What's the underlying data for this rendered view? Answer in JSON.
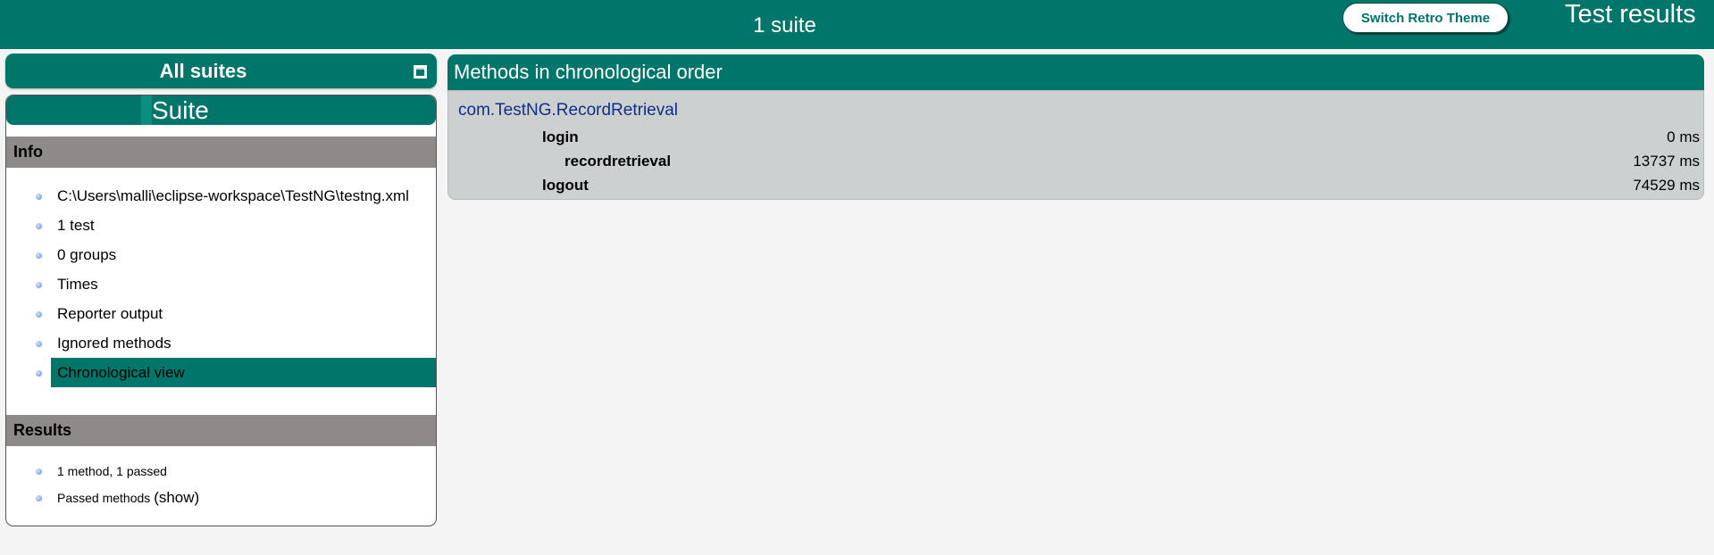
{
  "topbar": {
    "suite_count": "1 suite",
    "retro_button": "Switch Retro Theme",
    "title": "Test results"
  },
  "sidebar": {
    "all_suites": "All suites",
    "suite_name": "Suite",
    "info_heading": "Info",
    "info_items": [
      "C:\\Users\\malli\\eclipse-workspace\\TestNG\\testng.xml",
      "1 test",
      "0 groups",
      "Times",
      "Reporter output",
      "Ignored methods",
      "Chronological view"
    ],
    "results_heading": "Results",
    "results_items": [
      "1 method, 1 passed",
      "Passed methods"
    ],
    "show_link": "(show)"
  },
  "main": {
    "header": "Methods in chronological order",
    "class_name": "com.TestNG.RecordRetrieval",
    "methods": [
      {
        "name": "login",
        "time": "0 ms"
      },
      {
        "name": "recordretrieval",
        "time": "13737 ms"
      },
      {
        "name": "logout",
        "time": "74529 ms"
      }
    ]
  },
  "colors": {
    "accent": "#00756a",
    "section_header": "#8f8a8a",
    "methods_body": "#cdd0d0",
    "class_link": "#0f2f86"
  }
}
